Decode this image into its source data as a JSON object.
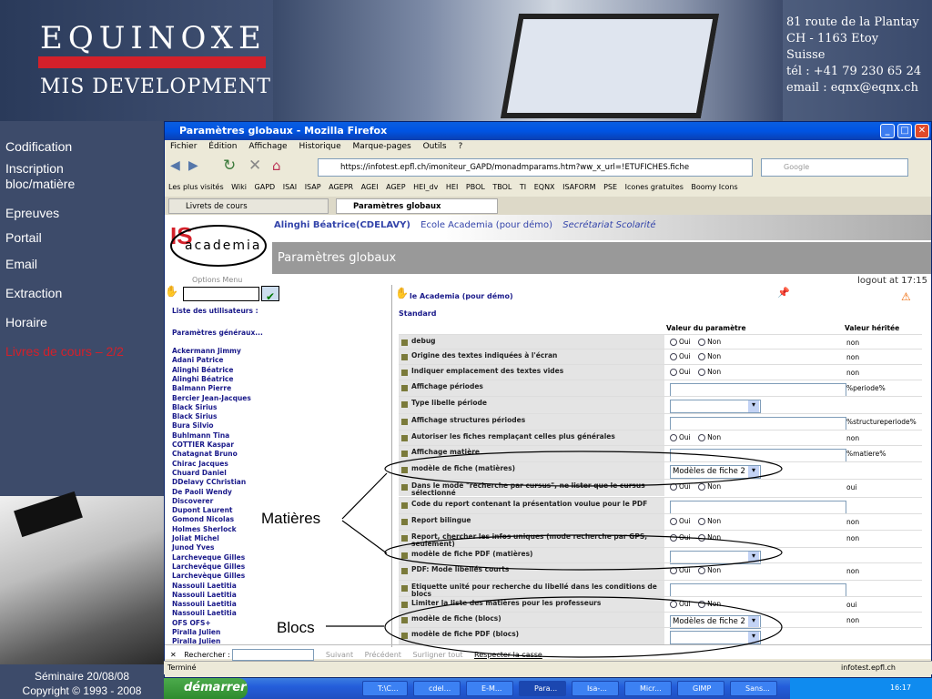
{
  "banner": {
    "brand_line1": "EQUINOXE",
    "brand_line2": "MIS DEVELOPMENT",
    "address": [
      "81 route de la Plantay",
      "CH - 1163 Etoy",
      "Suisse",
      "tél : +41 79 230 65 24",
      "email : eqnx@eqnx.ch"
    ]
  },
  "leftnav": {
    "items": [
      "Codification",
      "Inscription bloc/matière",
      "Epreuves",
      "Portail",
      "Email",
      "Extraction",
      "Horaire",
      "Livres de cours – 2/2"
    ],
    "active_color": "#d4202a",
    "footer_line1": "Séminaire 20/08/08",
    "footer_line2": "Copyright © 1993 - 2008"
  },
  "browser": {
    "title": "Paramètres globaux - Mozilla Firefox",
    "menu": [
      "Fichier",
      "Édition",
      "Affichage",
      "Historique",
      "Marque-pages",
      "Outils",
      "?"
    ],
    "url": "https://infotest.epfl.ch/imoniteur_GAPD/monadmparams.htm?ww_x_url=!ETUFICHES.fiche",
    "search_placeholder": "Google",
    "bookmarks": [
      "Les plus visités",
      "Wiki",
      "GAPD",
      "ISAI",
      "ISAP",
      "AGEPR",
      "AGEI",
      "AGEP",
      "HEI_dv",
      "HEI",
      "PBOL",
      "TBOL",
      "TI",
      "EQNX",
      "ISAFORM",
      "PSE",
      "Icones gratuites",
      "Boomy Icons"
    ],
    "tabs": [
      "Livrets de cours",
      "Paramètres globaux"
    ],
    "find_label": "Rechercher :",
    "find_next": "Suivant",
    "find_prev": "Précédent",
    "find_highlight": "Surligner tout",
    "find_case": "Respecter la casse",
    "status": "Terminé",
    "status_host": "infotest.epfl.ch"
  },
  "page": {
    "user_line": "Alinghi Béatrice(CDELAVY)",
    "school": "Ecole Academia (pour démo)",
    "role": "Secrétariat Scolarité",
    "title": "Paramètres globaux",
    "options_menu": "Options    Menu",
    "logout": "logout at 17:15",
    "logo_text": "academia",
    "left": {
      "head1": "Liste des utilisateurs :",
      "head2": "Paramètres généraux...",
      "names": [
        "Ackermann Jimmy",
        "Adani Patrice",
        "Alinghi Béatrice",
        "Alinghi Béatrice",
        "Balmann Pierre",
        "Bercier Jean-Jacques",
        "Black Sirius",
        "Black Sirius",
        "Bura Silvio",
        "Buhlmann Tina",
        "COTTIER Kaspar",
        "Chatagnat Bruno",
        "Chirac Jacques",
        "Chuard Daniel",
        "DDelavy CChristian",
        "De Paoli Wendy",
        "Discoverer",
        "Dupont Laurent",
        "Gomond Nicolas",
        "Holmes Sherlock",
        "Joliat Michel",
        "Junod Yves",
        "Larcheveque Gilles",
        "Larchevêque Gilles",
        "Larchevèque Gilles",
        "Nassouli Laetitia",
        "Nassouli Laetitia",
        "Nassouli Laetitia",
        "Nassouli Laetitia",
        "OFS OFS+",
        "Piralla Julien",
        "Piralla Julien"
      ]
    },
    "right": {
      "header": "le Academia (pour démo)",
      "section": "Standard",
      "col_value": "Valeur du paramètre",
      "col_inherited": "Valeur héritée",
      "oui": "Oui",
      "non": "Non",
      "rows": [
        {
          "label": "debug",
          "type": "radio",
          "inherited": "non"
        },
        {
          "label": "Origine des textes indiquées à l'écran",
          "type": "radio",
          "inherited": "non"
        },
        {
          "label": "Indiquer emplacement des textes vides",
          "type": "radio",
          "inherited": "non"
        },
        {
          "label": "Affichage périodes",
          "type": "text",
          "inherited": "%periode%"
        },
        {
          "label": "Type libelle période",
          "type": "select",
          "value": "",
          "inherited": ""
        },
        {
          "label": "Affichage structures périodes",
          "type": "text",
          "inherited": "%structureperiode%"
        },
        {
          "label": "Autoriser les fiches remplaçant celles plus générales",
          "type": "radio",
          "inherited": "non"
        },
        {
          "label": "Affichage matière",
          "type": "text",
          "inherited": "%matiere%"
        },
        {
          "label": "modèle de fiche (matières)",
          "type": "select",
          "value": "Modèles de fiche 2",
          "inherited": ""
        },
        {
          "label": "Dans le mode \"recherche par cursus\", ne lister que le cursus sélectionné",
          "type": "radio",
          "inherited": "oui"
        },
        {
          "label": "Code du report contenant la présentation voulue pour le PDF",
          "type": "text",
          "inherited": ""
        },
        {
          "label": "Report bilingue",
          "type": "radio",
          "inherited": "non"
        },
        {
          "label": "Report, chercher les infos uniques (mode recherche par GPS, seulement)",
          "type": "radio",
          "inherited": "non"
        },
        {
          "label": "modèle de fiche PDF (matières)",
          "type": "select",
          "value": "",
          "inherited": ""
        },
        {
          "label": "PDF: Mode libellés courts",
          "type": "radio",
          "inherited": "non"
        },
        {
          "label": "Etiquette unité pour recherche du libellé dans les conditions de blocs",
          "type": "text",
          "inherited": ""
        },
        {
          "label": "Limiter la liste des matières pour les professeurs",
          "type": "radio",
          "inherited": "oui"
        },
        {
          "label": "modèle de fiche (blocs)",
          "type": "select",
          "value": "Modèles de fiche 2",
          "inherited": "non"
        },
        {
          "label": "modèle de fiche PDF (blocs)",
          "type": "select",
          "value": "",
          "inherited": ""
        }
      ]
    }
  },
  "annotations": {
    "matieres": "Matières",
    "blocs": "Blocs"
  },
  "taskbar": {
    "start": "démarrer",
    "tasks": [
      "T:\\C...",
      "cdel...",
      "E-M...",
      "Para...",
      "Isa-...",
      "Micr...",
      "GIMP",
      "Sans..."
    ],
    "clock": "16:17"
  }
}
